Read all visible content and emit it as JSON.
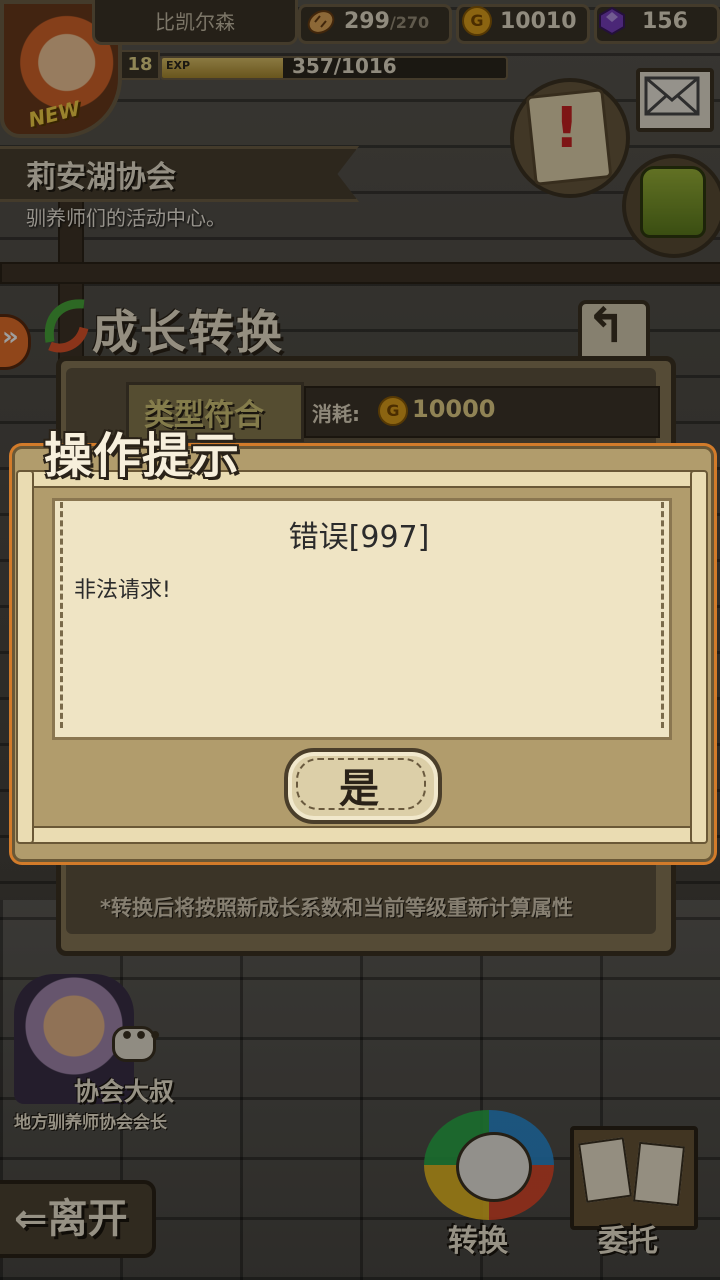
{
  "hud": {
    "player_name": "比凯尔森",
    "stamina": "299",
    "stamina_max": "/270",
    "gold": "10010",
    "gems": "156",
    "level": "18",
    "exp_label": "EXP",
    "exp_value": "357/1016",
    "exp_fraction": 0.351,
    "coin_glyph": "G",
    "avatar_badge": "NEW"
  },
  "location": {
    "title": "莉安湖协会",
    "subtitle": "驯养师们的活动中心。"
  },
  "panel": {
    "title": "成长转换",
    "type_match_label": "类型符合",
    "cost_label": "消耗:",
    "cost_value": "10000",
    "note": "*转换后将按照新成长系数和当前等级重新计算属性"
  },
  "npc": {
    "name": "协会大叔",
    "title": "地方驯养师协会会长"
  },
  "nav": {
    "leave_label": "离开",
    "convert_label": "转换",
    "task_label": "委托"
  },
  "dialog": {
    "title": "操作提示",
    "heading": "错误[997]",
    "message": "非法请求!",
    "confirm_label": "是"
  },
  "colors": {
    "accent_orange": "#d27b2a",
    "paper": "#efe4c4",
    "frame": "#b19c6c",
    "gold_coin": "#e0a21c",
    "gem": "#7a3fc0",
    "quest_mark": "#cc2222"
  },
  "icons": [
    "bread-icon",
    "gold-coin-icon",
    "gem-icon",
    "mail-icon",
    "quest-scroll-icon",
    "backpack-icon",
    "back-arrow-icon",
    "side-expand-icon",
    "chat-bubble-icon",
    "convert-icon",
    "task-board-icon"
  ]
}
